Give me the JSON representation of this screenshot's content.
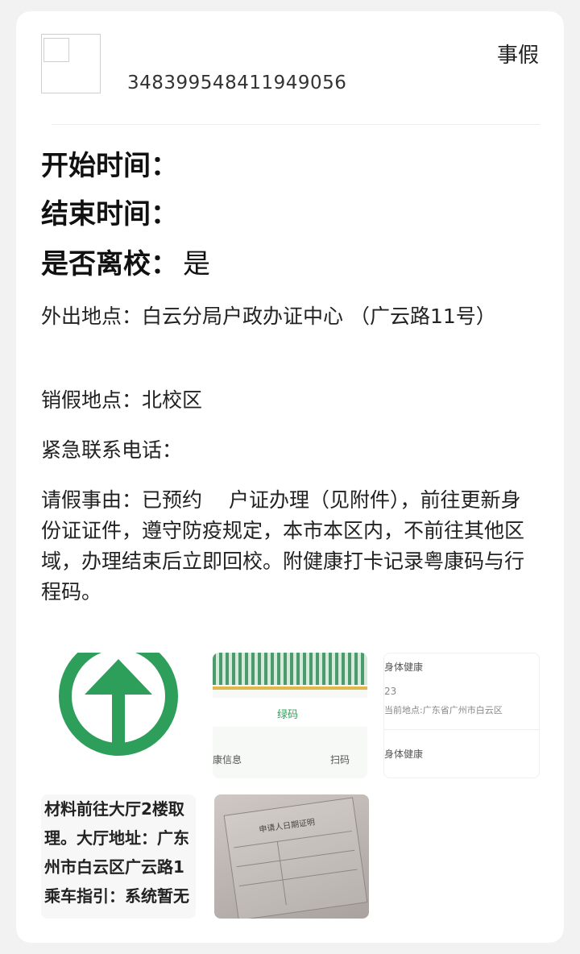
{
  "header": {
    "request_id": "348399548411949056",
    "leave_type": "事假"
  },
  "summary": {
    "start_label": "开始时间：",
    "end_label": "结束时间：",
    "leave_campus_label": "是否离校：",
    "leave_campus_value": "是"
  },
  "details": {
    "destination": "外出地点：白云分局户政办证中心 （广云路11号）",
    "cancel_location": "销假地点：北校区",
    "emergency_contact": "紧急联系电话：",
    "reason": "请假事由：已预约　 户证办理（见附件），前往更新身份证证件，遵守防疫规定，本市本区内，不前往其他区域，办理结束后立即回校。附健康打卡记录粤康码与行程码。"
  },
  "attachments": {
    "items": [
      {
        "name": "green-arrow-image"
      },
      {
        "name": "health-code-image",
        "label_top": "绿码",
        "label_left": "康信息",
        "label_right": "扫码"
      },
      {
        "name": "health-record-image",
        "line1": "身体健康",
        "line2": "23",
        "line3": "当前地点:广东省广州市白云区",
        "line4": "身体健康"
      },
      {
        "name": "office-notice-image",
        "lines": [
          "材料前往大厅2楼取",
          "理。大厅地址：广东",
          "州市白云区广云路1",
          "乘车指引：系统暂无"
        ]
      },
      {
        "name": "form-photo-image",
        "title": "申请人日期证明"
      }
    ]
  },
  "colors": {
    "accent_green": "#2e9e5b",
    "background": "#f2f2f2"
  }
}
